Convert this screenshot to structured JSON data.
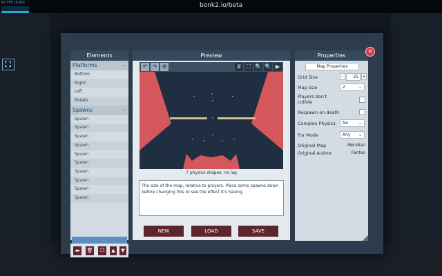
{
  "window": {
    "title": "bonk2.io/beta",
    "fps": "60 FPS (0-60)"
  },
  "elements": {
    "header": "Elements",
    "sections": [
      {
        "label": "Platforms",
        "collapse": "-",
        "items": [
          "Bottom",
          "Right",
          "Left",
          "Rotate"
        ]
      },
      {
        "label": "Spawns",
        "collapse": "-",
        "items": [
          "Spawn",
          "Spawn",
          "Spawn",
          "Spawn",
          "Spawn",
          "Spawn",
          "Spawn",
          "Spawn",
          "Spawn",
          "Spawn"
        ]
      }
    ],
    "footer_buttons": [
      {
        "name": "new-element-icon",
        "glyph": "▬"
      },
      {
        "name": "trash-icon",
        "glyph": "🗑"
      },
      {
        "name": "duplicate-icon",
        "glyph": "❐"
      },
      {
        "name": "move-up-icon",
        "glyph": "▲"
      },
      {
        "name": "move-down-icon",
        "glyph": "▼"
      }
    ]
  },
  "preview": {
    "header": "Preview",
    "toolbar": [
      {
        "name": "undo-icon",
        "glyph": "↶"
      },
      {
        "name": "redo-icon",
        "glyph": "↷"
      },
      {
        "name": "gear-icon",
        "glyph": "⚙"
      }
    ],
    "toolbar_right": [
      {
        "name": "grid-icon",
        "glyph": "#"
      },
      {
        "name": "fit-screen-icon",
        "glyph": "⛶"
      },
      {
        "name": "zoom-in-icon",
        "glyph": "🔍"
      },
      {
        "name": "zoom-out-icon",
        "glyph": "🔍"
      },
      {
        "name": "play-icon",
        "glyph": "▶"
      }
    ],
    "physics_note": "7 physics shapes: no lag",
    "help_text": "The size of the map, relative to players. Place some spawns down before changing this to see the effect it's having.",
    "buttons": {
      "new": "NEW",
      "load": "LOAD",
      "save": "SAVE"
    },
    "colors": {
      "background": "#1f2e40",
      "red_shape": "#d4575c",
      "platform": "#d8c08c",
      "spawn_dot": "#7d8fa0"
    }
  },
  "properties": {
    "header": "Properties",
    "map_properties_button": "Map Properties",
    "grid_size": {
      "label": "Grid Size",
      "minus": "-",
      "value": "25",
      "plus": "+"
    },
    "map_size": {
      "label": "Map size",
      "value": "2"
    },
    "players_dont_collide": {
      "label_line1": "Players don't",
      "label_line2": "collide"
    },
    "respawn_on_death": {
      "label": "Respawn on death"
    },
    "complex_physics": {
      "label": "Complex Physics",
      "value": "No"
    },
    "for_mode": {
      "label": "For Mode",
      "value": "Any"
    },
    "original_map": {
      "label": "Original Map",
      "value": "Meridian"
    },
    "original_author": {
      "label": "Original Author",
      "value": "Fantao"
    },
    "close_glyph": "×"
  },
  "colors": {
    "panel_header": "#364a5e",
    "panel_body": "#d4dce3",
    "accent_button": "#5c2530",
    "close": "#d63a4a",
    "scroll_accent": "#5b8ec2"
  }
}
